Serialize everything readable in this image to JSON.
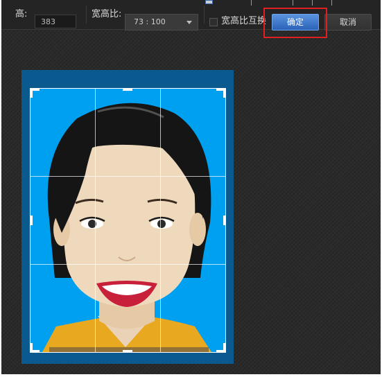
{
  "toolbar": {
    "height_label": "高:",
    "height_value": "383",
    "aspect_label": "宽高比:",
    "aspect_value": "73 : 100",
    "swap_label": "宽高比互换",
    "ok_label": "确定",
    "cancel_label": "取消"
  },
  "photo": {
    "background_color": "#00a0f0",
    "frame_color": "#0a5a90"
  },
  "colors": {
    "accent": "#3a78d0",
    "highlight": "#e02020"
  }
}
